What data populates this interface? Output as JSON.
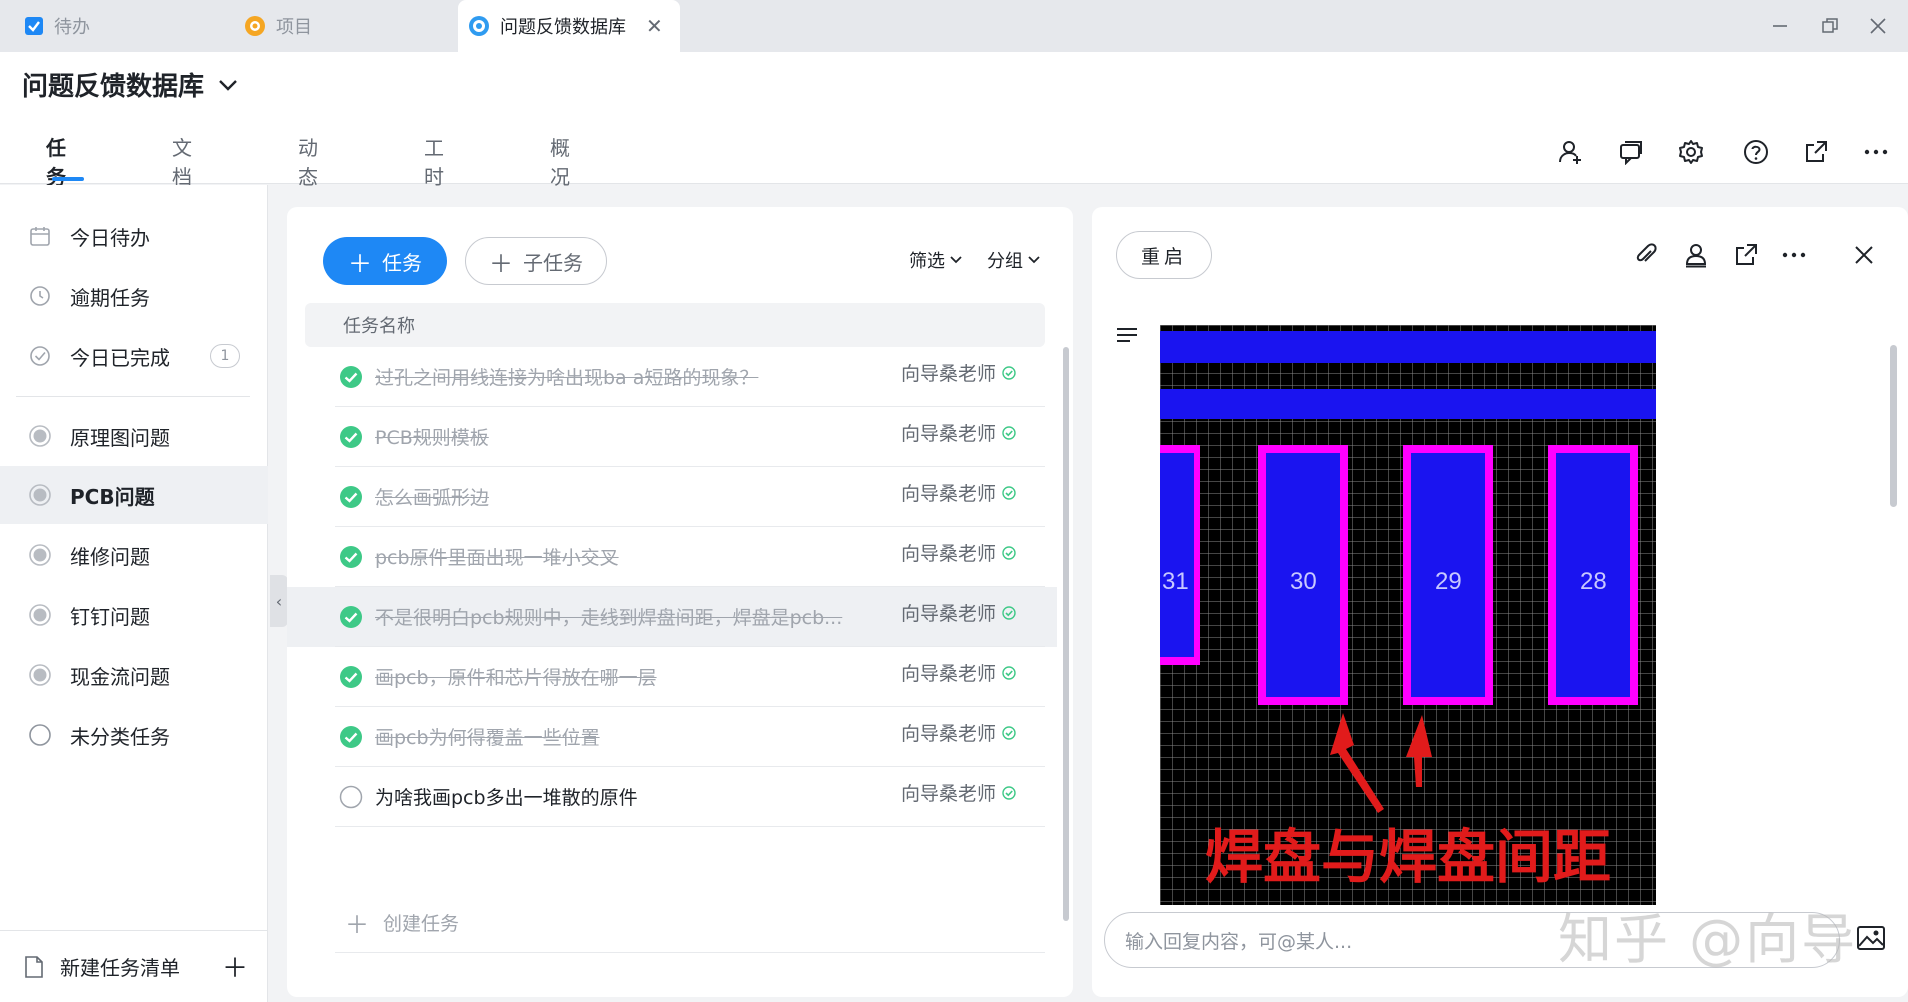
{
  "window_tabs": [
    {
      "label": "待办",
      "icon": "checkbox-icon"
    },
    {
      "label": "项目",
      "icon": "project-icon"
    },
    {
      "label": "问题反馈数据库",
      "icon": "database-icon",
      "active": true
    }
  ],
  "header": {
    "title": "问题反馈数据库",
    "nav_tabs": [
      "任务",
      "文档",
      "动态",
      "工时",
      "概况"
    ],
    "active_tab": "任务"
  },
  "sidebar": {
    "items": [
      {
        "label": "今日待办",
        "icon": "calendar-icon"
      },
      {
        "label": "逾期任务",
        "icon": "clock-icon"
      },
      {
        "label": "今日已完成",
        "icon": "check-circle-icon",
        "count": "1"
      },
      {
        "label": "原理图问题",
        "icon": "list-dot-icon"
      },
      {
        "label": "PCB问题",
        "icon": "list-dot-icon",
        "active": true
      },
      {
        "label": "维修问题",
        "icon": "list-dot-icon"
      },
      {
        "label": "钉钉问题",
        "icon": "list-dot-icon"
      },
      {
        "label": "现金流问题",
        "icon": "list-dot-icon"
      },
      {
        "label": "未分类任务",
        "icon": "empty-circle-icon"
      }
    ],
    "new_list_label": "新建任务清单"
  },
  "tasks": {
    "add_task_label": "任务",
    "add_subtask_label": "子任务",
    "filter_label": "筛选",
    "group_label": "分组",
    "column_header": "任务名称",
    "rows": [
      {
        "name": "过孔之间用线连接为啥出现ba a短路的现象？",
        "assignee": "向导桑老师",
        "done": true
      },
      {
        "name": "PCB规则模板",
        "assignee": "向导桑老师",
        "done": true
      },
      {
        "name": "怎么画弧形边",
        "assignee": "向导桑老师",
        "done": true
      },
      {
        "name": "pcb原件里面出现一堆小交叉",
        "assignee": "向导桑老师",
        "done": true
      },
      {
        "name": "不是很明白pcb规则中，走线到焊盘间距，焊盘是pcb...",
        "assignee": "向导桑老师",
        "done": true,
        "selected": true
      },
      {
        "name": "画pcb，原件和芯片得放在哪一层",
        "assignee": "向导桑老师",
        "done": true
      },
      {
        "name": "画pcb为何得覆盖一些位置",
        "assignee": "向导桑老师",
        "done": true
      },
      {
        "name": "为啥我画pcb多出一堆散的原件",
        "assignee": "向导桑老师",
        "done": false
      }
    ],
    "create_label": "创建任务"
  },
  "detail": {
    "reopen_label": "重启",
    "image": {
      "pad_labels": [
        "31",
        "30",
        "29",
        "28"
      ],
      "caption": "焊盘与焊盘间距"
    },
    "reply_placeholder": "输入回复内容，可@某人..."
  },
  "watermark": "知乎 @向导",
  "colors": {
    "accent": "#1e88f5",
    "done_green": "#3ec987",
    "pad_blue": "#1a14f0",
    "pad_magenta": "#ff00ff",
    "caption_red": "#e11b1b"
  }
}
